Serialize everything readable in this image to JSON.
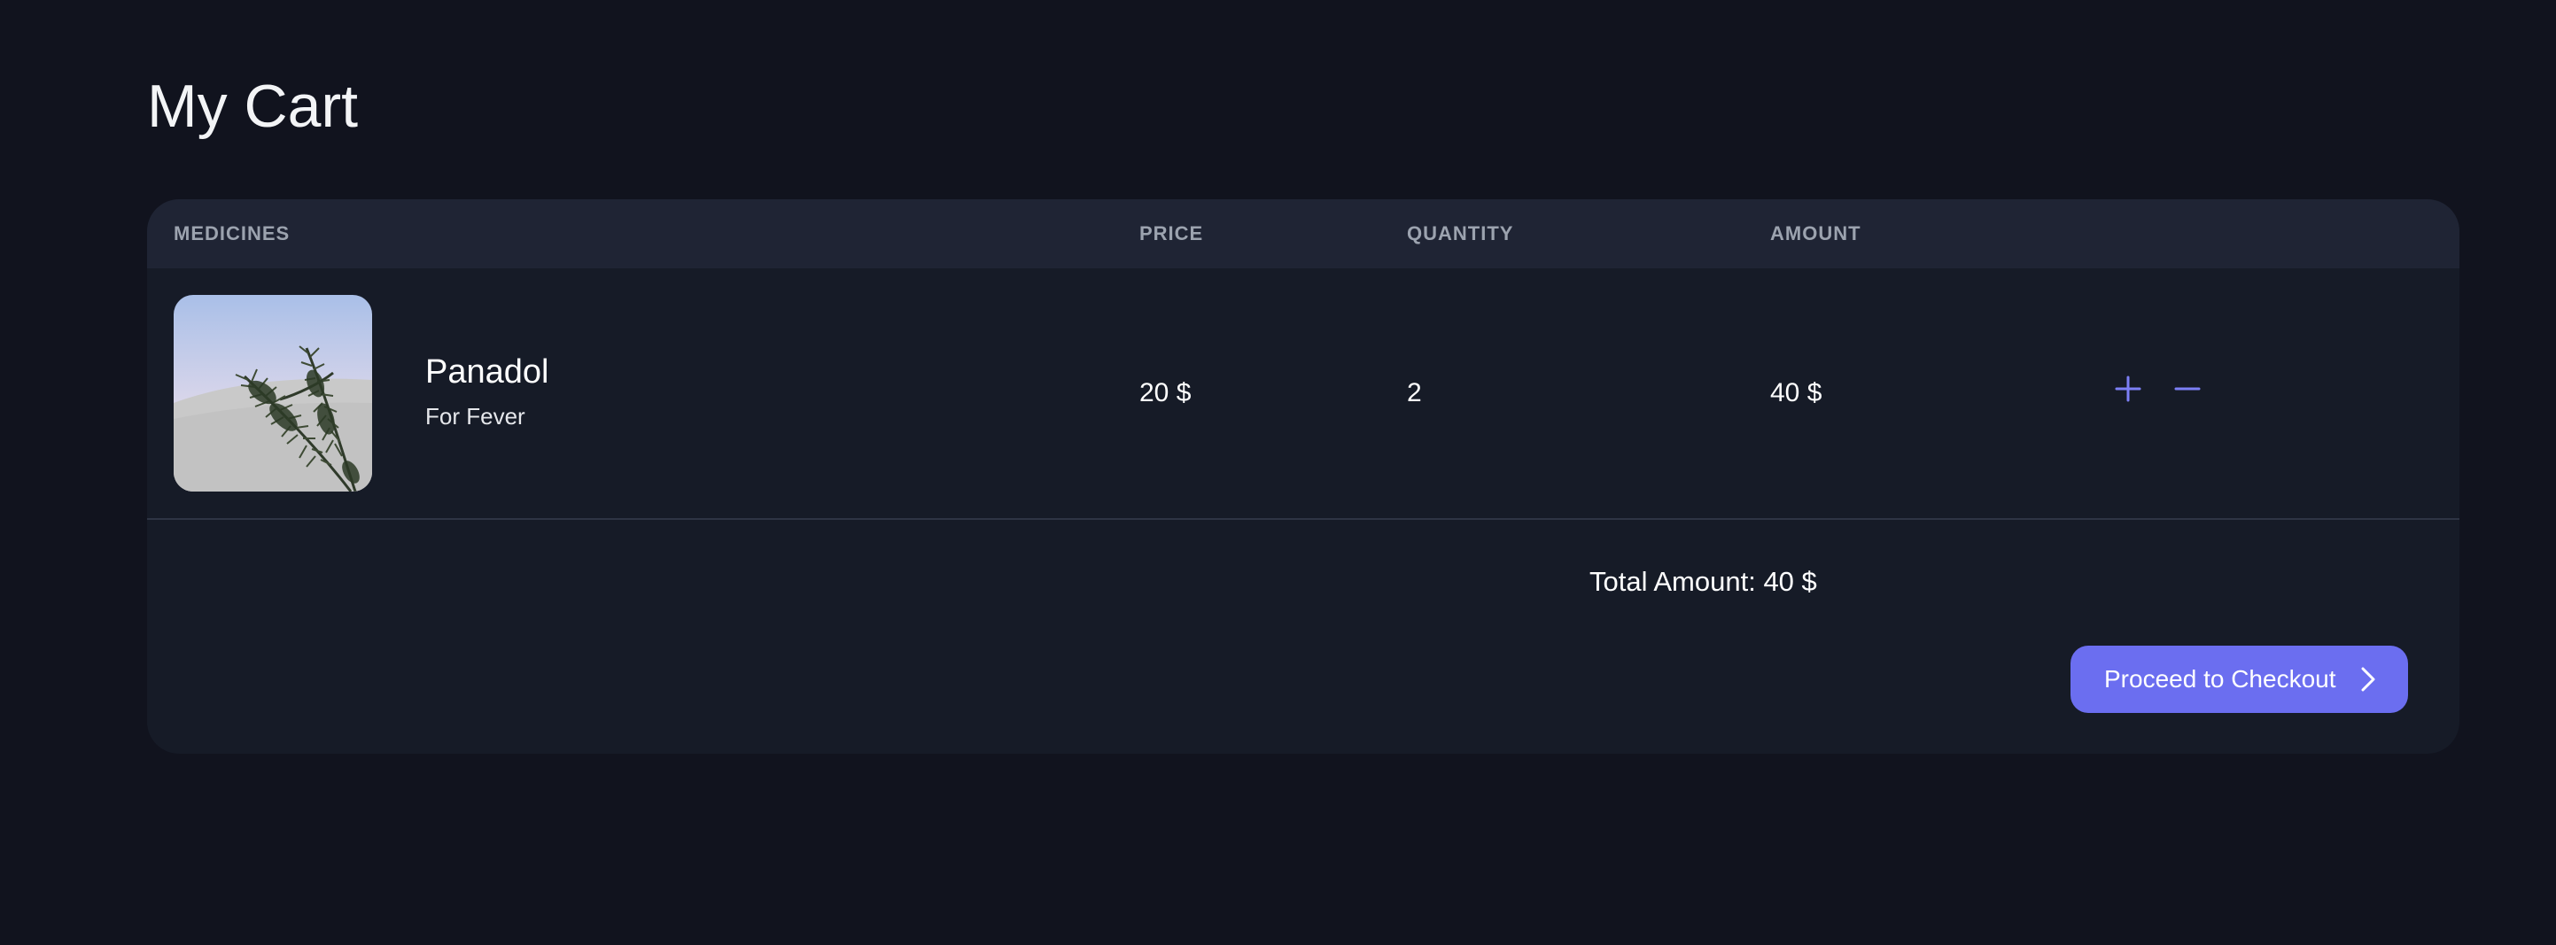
{
  "page": {
    "title": "My Cart"
  },
  "table": {
    "headers": {
      "medicines": "MEDICINES",
      "price": "PRICE",
      "quantity": "QUANTITY",
      "amount": "AMOUNT"
    },
    "rows": [
      {
        "name": "Panadol",
        "description": "For Fever",
        "price": "20 $",
        "quantity": "2",
        "amount": "40 $",
        "image_icon": "pine-branch-photo"
      }
    ]
  },
  "actions": {
    "increment_icon": "plus-icon",
    "decrement_icon": "minus-icon"
  },
  "summary": {
    "total": "Total Amount: 40 $"
  },
  "checkout": {
    "label": "Proceed to Checkout",
    "icon": "chevron-right-icon"
  },
  "colors": {
    "background": "#11131e",
    "panel": "#161b27",
    "header": "#1f2434",
    "accent": "#6b6ef0",
    "icon_accent": "#7c7ff5",
    "header_text": "#9ca3af"
  }
}
